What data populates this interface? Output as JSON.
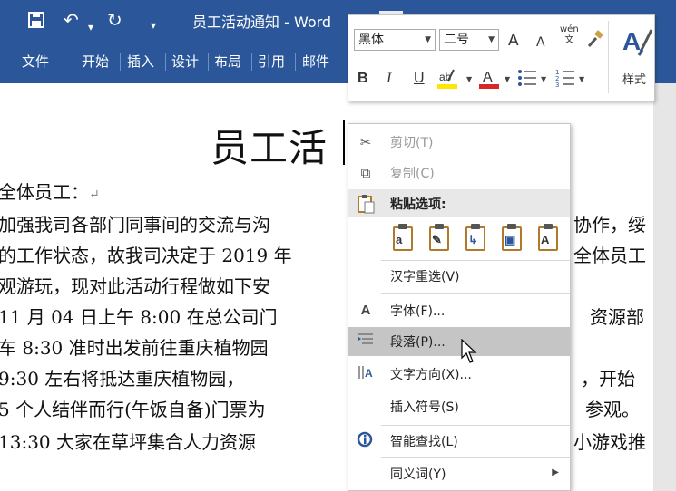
{
  "window": {
    "title": "员工活动通知 - Word",
    "tabs": [
      "文件",
      "开始",
      "插入",
      "设计",
      "布局",
      "引用",
      "邮件"
    ]
  },
  "quick_access": {
    "save_icon": "save-icon",
    "undo_icon": "undo-icon",
    "redo_icon": "redo-icon",
    "customize_icon": "customize-icon"
  },
  "document": {
    "title": "员工活",
    "lines": [
      "全体员工：",
      "加强我司各部门同事间的交流与沟",
      "的工作状态，故我司决定于 2019 年",
      "观游玩，现对此活动行程做如下安",
      " 11 月 04 日上午 8:00 在总公司门",
      "车 8:30 准时出发前往重庆植物园",
      " 9:30 左右将抵达重庆植物园，",
      "5 个人结伴而行(午饭自备)门票为",
      " 13:30 大家在草坪集合人力资源"
    ],
    "right_fragments": [
      "协作，绥",
      "全体员工",
      "资源部",
      "，开始",
      "参观。",
      "小游戏推"
    ],
    "paragraph_mark": "↵"
  },
  "mini_toolbar": {
    "font_name": "黑体",
    "font_size": "二号",
    "grow_font": "A",
    "shrink_font": "A",
    "phonetic_guide": "wén\n文",
    "bold": "B",
    "italic": "I",
    "underline": "U",
    "styles_label": "样式"
  },
  "context_menu": {
    "items": [
      {
        "label": "剪切(T)",
        "icon": "cut-icon",
        "disabled": true
      },
      {
        "label": "复制(C)",
        "icon": "copy-icon",
        "disabled": true
      },
      {
        "label": "粘贴选项:",
        "icon": "paste-icon",
        "header": true
      },
      {
        "label": "汉字重选(V)"
      },
      {
        "label": "字体(F)...",
        "icon": "font-icon"
      },
      {
        "label": "段落(P)...",
        "icon": "paragraph-icon",
        "hover": true
      },
      {
        "label": "文字方向(X)...",
        "icon": "text-direction-icon"
      },
      {
        "label": "插入符号(S)"
      },
      {
        "label": "智能查找(L)",
        "icon": "smart-lookup-icon"
      },
      {
        "label": "同义词(Y)",
        "submenu": true
      }
    ],
    "paste_options": [
      "a",
      "✎",
      "↳",
      "▣",
      "A"
    ]
  },
  "colors": {
    "ribbon_blue": "#2b579a",
    "highlight_yellow": "#ffe600",
    "font_color_red": "#d92626",
    "menu_hover": "#c5c5c5"
  }
}
